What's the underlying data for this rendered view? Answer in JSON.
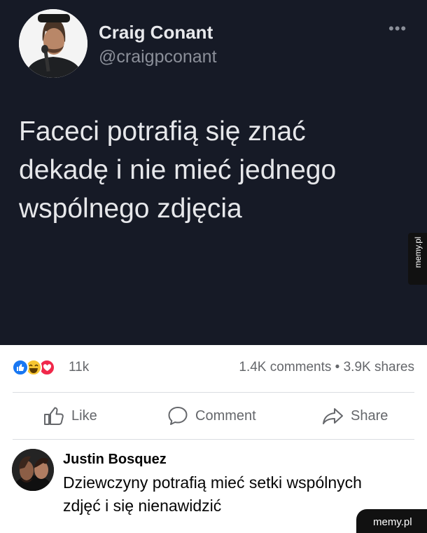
{
  "tweet": {
    "author_name": "Craig Conant",
    "author_handle": "@craigpconant",
    "more_icon": "more-dots-icon",
    "text": "Faceci potrafią się znać dekadę i nie mieć jednego wspólnego zdjęcia"
  },
  "post": {
    "reactions": [
      "like",
      "haha",
      "love"
    ],
    "reaction_count": "11k",
    "stats": "1.4K comments • 3.9K shares"
  },
  "actions": {
    "like_label": "Like",
    "comment_label": "Comment",
    "share_label": "Share"
  },
  "comment": {
    "author": "Justin Bosquez",
    "text": "Dziewczyny potrafią mieć setki wspólnych zdjęć i się nienawidzić"
  },
  "watermarks": {
    "side": "memy.pl",
    "corner": "memy.pl"
  },
  "colors": {
    "tweet_bg": "#161a26",
    "facebook_blue": "#1877f2",
    "haha_yellow": "#f7c531",
    "love_red": "#f0284a"
  }
}
